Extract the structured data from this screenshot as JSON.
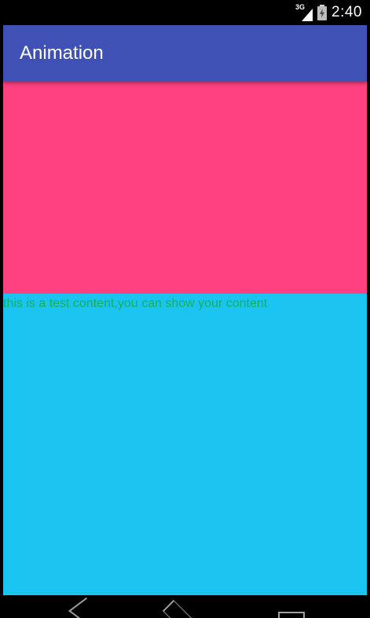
{
  "status_bar": {
    "network_type": "3G",
    "time": "2:40",
    "icons": [
      "signal-icon",
      "battery-charging-icon"
    ]
  },
  "app_bar": {
    "title": "Animation",
    "color": "#3F51B5"
  },
  "content": {
    "top_block_color": "#FF4081",
    "bottom_block_color": "#1BC3F1",
    "text": "this is a test content,you can show your content",
    "text_color": "#15B15A"
  },
  "nav_bar": {
    "buttons": [
      "back-icon",
      "home-icon",
      "recent-apps-icon"
    ]
  }
}
